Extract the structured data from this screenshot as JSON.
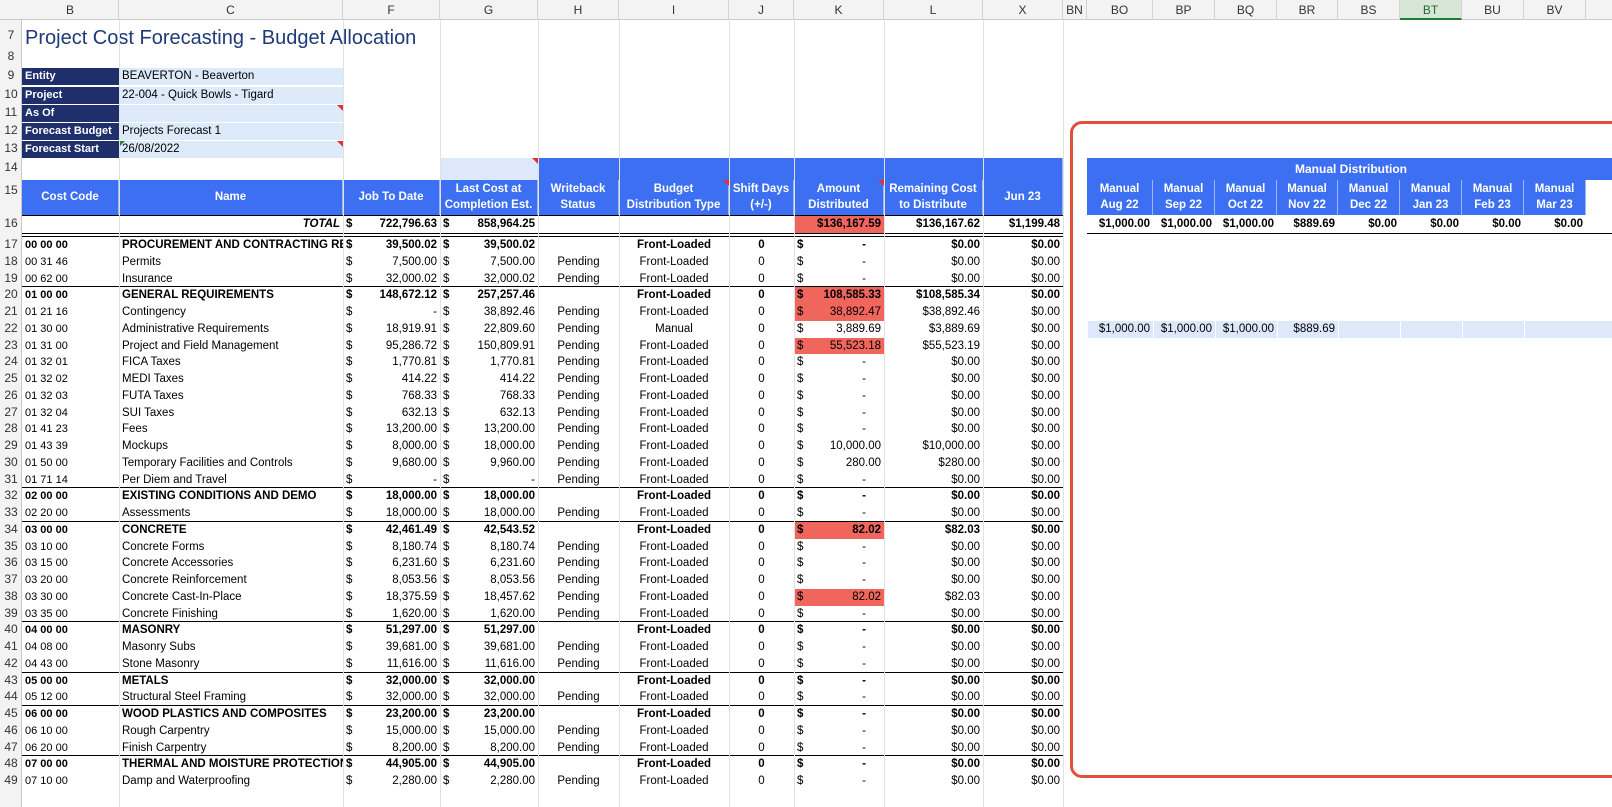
{
  "colhdrs": [
    {
      "label": "B",
      "l": 22,
      "w": 97
    },
    {
      "label": "C",
      "l": 119,
      "w": 224
    },
    {
      "label": "F",
      "l": 343,
      "w": 97
    },
    {
      "label": "G",
      "l": 440,
      "w": 98
    },
    {
      "label": "H",
      "l": 538,
      "w": 81
    },
    {
      "label": "I",
      "l": 619,
      "w": 110
    },
    {
      "label": "J",
      "l": 729,
      "w": 65
    },
    {
      "label": "K",
      "l": 794,
      "w": 90
    },
    {
      "label": "L",
      "l": 884,
      "w": 99
    },
    {
      "label": "X",
      "l": 983,
      "w": 80
    },
    {
      "label": "BN",
      "l": 1063,
      "w": 24
    },
    {
      "label": "BO",
      "l": 1087,
      "w": 66
    },
    {
      "label": "BP",
      "l": 1153,
      "w": 62
    },
    {
      "label": "BQ",
      "l": 1215,
      "w": 62
    },
    {
      "label": "BR",
      "l": 1277,
      "w": 61
    },
    {
      "label": "BS",
      "l": 1338,
      "w": 62
    },
    {
      "label": "BT",
      "l": 1400,
      "w": 62
    },
    {
      "label": "BU",
      "l": 1462,
      "w": 62
    },
    {
      "label": "BV",
      "l": 1524,
      "w": 62
    }
  ],
  "title": "Project Cost Forecasting - Budget Allocation",
  "meta": [
    {
      "label": "Entity",
      "value": "BEAVERTON - Beaverton"
    },
    {
      "label": "Project",
      "value": "22-004 - Quick Bowls - Tigard"
    },
    {
      "label": "As Of",
      "value": ""
    },
    {
      "label": "Forecast Budget",
      "value": "Projects Forecast 1"
    },
    {
      "label": "Forecast Start",
      "value": "26/08/2022"
    }
  ],
  "headers": {
    "cost_code": "Cost Code",
    "name": "Name",
    "job_to_date": "Job To Date",
    "last_cost": "Last Cost at Completion Est.",
    "writeback": "Writeback Status",
    "bdt": "Budget Distribution Type",
    "shift": "Shift Days (+/-)",
    "amount": "Amount Distributed",
    "remaining": "Remaining Cost to Distribute",
    "jun23": "Jun 23",
    "manual_distribution": "Manual Distribution"
  },
  "manual_cols": [
    "Manual Aug 22",
    "Manual Sep 22",
    "Manual Oct 22",
    "Manual Nov 22",
    "Manual Dec 22",
    "Manual Jan 23",
    "Manual Feb 23",
    "Manual Mar 23"
  ],
  "total": {
    "label": "TOTAL",
    "jtd": "722,796.63",
    "lce": "858,964.25",
    "amount": "$136,167.59",
    "remaining": "$136,167.62",
    "jun": "$1,199.48",
    "manual": [
      "$1,000.00",
      "$1,000.00",
      "$1,000.00",
      "$889.69",
      "$0.00",
      "$0.00",
      "$0.00",
      "$0.00"
    ]
  },
  "rows": [
    {
      "n": "17",
      "code": "00 00 00",
      "name": "PROCUREMENT AND CONTRACTING RE",
      "jtd": "39,500.02",
      "lce": "39,500.02",
      "ws": "",
      "bdt": "Front-Loaded",
      "shift": "0",
      "amt": "-",
      "rem": "$0.00",
      "jun": "$0.00",
      "bold": true
    },
    {
      "n": "18",
      "code": "00 31 46",
      "name": "Permits",
      "jtd": "7,500.00",
      "lce": "7,500.00",
      "ws": "Pending",
      "bdt": "Front-Loaded",
      "shift": "0",
      "amt": "-",
      "rem": "$0.00",
      "jun": "$0.00"
    },
    {
      "n": "19",
      "code": "00 62 00",
      "name": "Insurance",
      "jtd": "32,000.02",
      "lce": "32,000.02",
      "ws": "Pending",
      "bdt": "Front-Loaded",
      "shift": "0",
      "amt": "-",
      "rem": "$0.00",
      "jun": "$0.00"
    },
    {
      "n": "20",
      "code": "01 00 00",
      "name": "GENERAL REQUIREMENTS",
      "jtd": "148,672.12",
      "lce": "257,257.46",
      "ws": "",
      "bdt": "Front-Loaded",
      "shift": "0",
      "amt": "108,585.33",
      "rem": "$108,585.34",
      "jun": "$0.00",
      "bold": true,
      "red": true
    },
    {
      "n": "21",
      "code": "01 21 16",
      "name": "Contingency",
      "jtd": "-",
      "lce": "38,892.46",
      "ws": "Pending",
      "bdt": "Front-Loaded",
      "shift": "0",
      "amt": "38,892.47",
      "rem": "$38,892.46",
      "jun": "$0.00",
      "red": true
    },
    {
      "n": "22",
      "code": "01 30 00",
      "name": "Administrative Requirements",
      "jtd": "18,919.91",
      "lce": "22,809.60",
      "ws": "Pending",
      "bdt": "Manual",
      "shift": "0",
      "amt": "3,889.69",
      "rem": "$3,889.69",
      "jun": "$0.00",
      "manual": [
        "$1,000.00",
        "$1,000.00",
        "$1,000.00",
        "$889.69",
        "",
        "",
        "",
        ""
      ]
    },
    {
      "n": "23",
      "code": "01 31 00",
      "name": "Project and Field Management",
      "jtd": "95,286.72",
      "lce": "150,809.91",
      "ws": "Pending",
      "bdt": "Front-Loaded",
      "shift": "0",
      "amt": "55,523.18",
      "rem": "$55,523.19",
      "jun": "$0.00",
      "red": true
    },
    {
      "n": "24",
      "code": "01 32 01",
      "name": "FICA Taxes",
      "jtd": "1,770.81",
      "lce": "1,770.81",
      "ws": "Pending",
      "bdt": "Front-Loaded",
      "shift": "0",
      "amt": "-",
      "rem": "$0.00",
      "jun": "$0.00"
    },
    {
      "n": "25",
      "code": "01 32 02",
      "name": "MEDI Taxes",
      "jtd": "414.22",
      "lce": "414.22",
      "ws": "Pending",
      "bdt": "Front-Loaded",
      "shift": "0",
      "amt": "-",
      "rem": "$0.00",
      "jun": "$0.00"
    },
    {
      "n": "26",
      "code": "01 32 03",
      "name": "FUTA Taxes",
      "jtd": "768.33",
      "lce": "768.33",
      "ws": "Pending",
      "bdt": "Front-Loaded",
      "shift": "0",
      "amt": "-",
      "rem": "$0.00",
      "jun": "$0.00"
    },
    {
      "n": "27",
      "code": "01 32 04",
      "name": "SUI Taxes",
      "jtd": "632.13",
      "lce": "632.13",
      "ws": "Pending",
      "bdt": "Front-Loaded",
      "shift": "0",
      "amt": "-",
      "rem": "$0.00",
      "jun": "$0.00"
    },
    {
      "n": "28",
      "code": "01 41 23",
      "name": "Fees",
      "jtd": "13,200.00",
      "lce": "13,200.00",
      "ws": "Pending",
      "bdt": "Front-Loaded",
      "shift": "0",
      "amt": "-",
      "rem": "$0.00",
      "jun": "$0.00"
    },
    {
      "n": "29",
      "code": "01 43 39",
      "name": "Mockups",
      "jtd": "8,000.00",
      "lce": "18,000.00",
      "ws": "Pending",
      "bdt": "Front-Loaded",
      "shift": "0",
      "amt": "10,000.00",
      "rem": "$10,000.00",
      "jun": "$0.00"
    },
    {
      "n": "30",
      "code": "01 50 00",
      "name": "Temporary Facilities and Controls",
      "jtd": "9,680.00",
      "lce": "9,960.00",
      "ws": "Pending",
      "bdt": "Front-Loaded",
      "shift": "0",
      "amt": "280.00",
      "rem": "$280.00",
      "jun": "$0.00"
    },
    {
      "n": "31",
      "code": "01 71 14",
      "name": "Per Diem and Travel",
      "jtd": "-",
      "lce": "-",
      "ws": "Pending",
      "bdt": "Front-Loaded",
      "shift": "0",
      "amt": "-",
      "rem": "$0.00",
      "jun": "$0.00"
    },
    {
      "n": "32",
      "code": "02 00 00",
      "name": "EXISTING CONDITIONS AND DEMO",
      "jtd": "18,000.00",
      "lce": "18,000.00",
      "ws": "",
      "bdt": "Front-Loaded",
      "shift": "0",
      "amt": "-",
      "rem": "$0.00",
      "jun": "$0.00",
      "bold": true
    },
    {
      "n": "33",
      "code": "02 20 00",
      "name": "Assessments",
      "jtd": "18,000.00",
      "lce": "18,000.00",
      "ws": "Pending",
      "bdt": "Front-Loaded",
      "shift": "0",
      "amt": "-",
      "rem": "$0.00",
      "jun": "$0.00"
    },
    {
      "n": "34",
      "code": "03 00 00",
      "name": "CONCRETE",
      "jtd": "42,461.49",
      "lce": "42,543.52",
      "ws": "",
      "bdt": "Front-Loaded",
      "shift": "0",
      "amt": "82.02",
      "rem": "$82.03",
      "jun": "$0.00",
      "bold": true,
      "red": true
    },
    {
      "n": "35",
      "code": "03 10 00",
      "name": "Concrete Forms",
      "jtd": "8,180.74",
      "lce": "8,180.74",
      "ws": "Pending",
      "bdt": "Front-Loaded",
      "shift": "0",
      "amt": "-",
      "rem": "$0.00",
      "jun": "$0.00"
    },
    {
      "n": "36",
      "code": "03 15 00",
      "name": "Concrete Accessories",
      "jtd": "6,231.60",
      "lce": "6,231.60",
      "ws": "Pending",
      "bdt": "Front-Loaded",
      "shift": "0",
      "amt": "-",
      "rem": "$0.00",
      "jun": "$0.00"
    },
    {
      "n": "37",
      "code": "03 20 00",
      "name": "Concrete Reinforcement",
      "jtd": "8,053.56",
      "lce": "8,053.56",
      "ws": "Pending",
      "bdt": "Front-Loaded",
      "shift": "0",
      "amt": "-",
      "rem": "$0.00",
      "jun": "$0.00"
    },
    {
      "n": "38",
      "code": "03 30 00",
      "name": "Concrete Cast-In-Place",
      "jtd": "18,375.59",
      "lce": "18,457.62",
      "ws": "Pending",
      "bdt": "Front-Loaded",
      "shift": "0",
      "amt": "82.02",
      "rem": "$82.03",
      "jun": "$0.00",
      "red": true
    },
    {
      "n": "39",
      "code": "03 35 00",
      "name": "Concrete Finishing",
      "jtd": "1,620.00",
      "lce": "1,620.00",
      "ws": "Pending",
      "bdt": "Front-Loaded",
      "shift": "0",
      "amt": "-",
      "rem": "$0.00",
      "jun": "$0.00"
    },
    {
      "n": "40",
      "code": "04 00 00",
      "name": "MASONRY",
      "jtd": "51,297.00",
      "lce": "51,297.00",
      "ws": "",
      "bdt": "Front-Loaded",
      "shift": "0",
      "amt": "-",
      "rem": "$0.00",
      "jun": "$0.00",
      "bold": true
    },
    {
      "n": "41",
      "code": "04 08 00",
      "name": "Masonry Subs",
      "jtd": "39,681.00",
      "lce": "39,681.00",
      "ws": "Pending",
      "bdt": "Front-Loaded",
      "shift": "0",
      "amt": "-",
      "rem": "$0.00",
      "jun": "$0.00"
    },
    {
      "n": "42",
      "code": "04 43 00",
      "name": "Stone Masonry",
      "jtd": "11,616.00",
      "lce": "11,616.00",
      "ws": "Pending",
      "bdt": "Front-Loaded",
      "shift": "0",
      "amt": "-",
      "rem": "$0.00",
      "jun": "$0.00"
    },
    {
      "n": "43",
      "code": "05 00 00",
      "name": "METALS",
      "jtd": "32,000.00",
      "lce": "32,000.00",
      "ws": "",
      "bdt": "Front-Loaded",
      "shift": "0",
      "amt": "-",
      "rem": "$0.00",
      "jun": "$0.00",
      "bold": true
    },
    {
      "n": "44",
      "code": "05 12 00",
      "name": "Structural Steel Framing",
      "jtd": "32,000.00",
      "lce": "32,000.00",
      "ws": "Pending",
      "bdt": "Front-Loaded",
      "shift": "0",
      "amt": "-",
      "rem": "$0.00",
      "jun": "$0.00"
    },
    {
      "n": "45",
      "code": "06 00 00",
      "name": "WOOD PLASTICS AND COMPOSITES",
      "jtd": "23,200.00",
      "lce": "23,200.00",
      "ws": "",
      "bdt": "Front-Loaded",
      "shift": "0",
      "amt": "-",
      "rem": "$0.00",
      "jun": "$0.00",
      "bold": true
    },
    {
      "n": "46",
      "code": "06 10 00",
      "name": "Rough Carpentry",
      "jtd": "15,000.00",
      "lce": "15,000.00",
      "ws": "Pending",
      "bdt": "Front-Loaded",
      "shift": "0",
      "amt": "-",
      "rem": "$0.00",
      "jun": "$0.00"
    },
    {
      "n": "47",
      "code": "06 20 00",
      "name": "Finish Carpentry",
      "jtd": "8,200.00",
      "lce": "8,200.00",
      "ws": "Pending",
      "bdt": "Front-Loaded",
      "shift": "0",
      "amt": "-",
      "rem": "$0.00",
      "jun": "$0.00"
    },
    {
      "n": "48",
      "code": "07 00 00",
      "name": "THERMAL AND MOISTURE PROTECTION",
      "jtd": "44,905.00",
      "lce": "44,905.00",
      "ws": "",
      "bdt": "Front-Loaded",
      "shift": "0",
      "amt": "-",
      "rem": "$0.00",
      "jun": "$0.00",
      "bold": true
    },
    {
      "n": "49",
      "code": "07 10 00",
      "name": "Damp and Waterproofing",
      "jtd": "2,280.00",
      "lce": "2,280.00",
      "ws": "Pending",
      "bdt": "Front-Loaded",
      "shift": "0",
      "amt": "-",
      "rem": "$0.00",
      "jun": "$0.00"
    }
  ],
  "header_rownums": [
    "7",
    "8",
    "9",
    "10",
    "11",
    "12",
    "13",
    "14",
    "15",
    "16"
  ]
}
